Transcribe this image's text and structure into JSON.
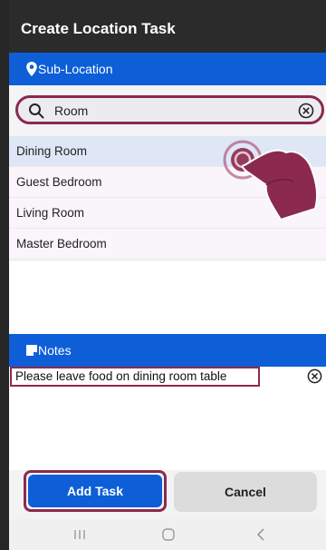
{
  "window": {
    "title": "Create Location Task"
  },
  "sub_location": {
    "header_label": "Sub-Location",
    "search": {
      "value": "Room",
      "placeholder": ""
    },
    "items": [
      {
        "label": "Dining Room",
        "selected": true
      },
      {
        "label": "Guest Bedroom",
        "selected": false
      },
      {
        "label": "Living Room",
        "selected": false
      },
      {
        "label": "Master Bedroom",
        "selected": false
      }
    ]
  },
  "notes": {
    "header_label": "Notes",
    "value": "Please leave food on dining room table"
  },
  "actions": {
    "add_label": "Add Task",
    "cancel_label": "Cancel"
  },
  "colors": {
    "accent": "#0d5ed7",
    "highlight": "#8b2a4c",
    "title_bg": "#2b2b2b"
  }
}
